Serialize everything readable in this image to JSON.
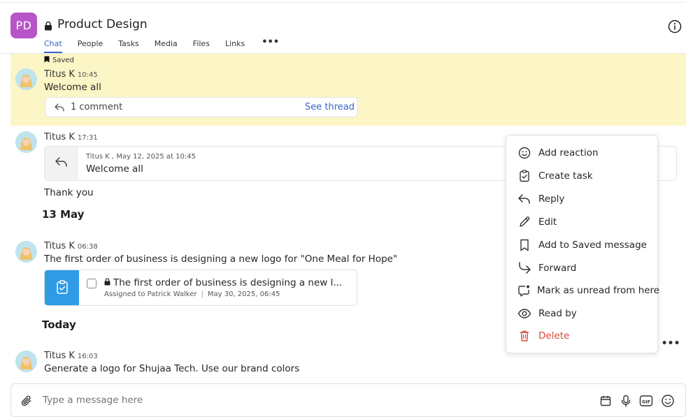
{
  "header": {
    "avatar_initials": "PD",
    "avatar_color": "#b755c8",
    "title": "Product Design",
    "tabs": [
      {
        "label": "Chat",
        "active": true
      },
      {
        "label": "People"
      },
      {
        "label": "Tasks"
      },
      {
        "label": "Media"
      },
      {
        "label": "Files"
      },
      {
        "label": "Links"
      }
    ],
    "more_label": "•••",
    "icons": {
      "lock": "lock-icon",
      "info": "info-icon"
    }
  },
  "saved_message": {
    "tag": "Saved",
    "author": "Titus K",
    "time": "10:45",
    "text": "Welcome all",
    "comment_count": "1 comment",
    "see_thread": "See thread",
    "highlight_color": "#fcf5c6"
  },
  "reply_message": {
    "author": "Titus K",
    "time": "17:31",
    "quote_meta": "Titus K , May 12, 2025 at 10:45",
    "quote_text": "Welcome all",
    "text": "Thank you"
  },
  "date_separators": [
    "13 May",
    "Today"
  ],
  "task_message": {
    "author": "Titus K",
    "time": "06:38",
    "text": "The first order of business is designing a new logo for \"One Meal for Hope\"",
    "task_title": "The first order of business is designing a new l...",
    "assigned_label": "Assigned to",
    "assignee": "Patrick Walker",
    "due": "May 30, 2025, 06:45"
  },
  "today_message": {
    "author": "Titus K",
    "time": "16:03",
    "text": "Generate a logo for Shujaa Tech. Use our brand colors",
    "more_label": "•••"
  },
  "context_menu": [
    {
      "label": "Add reaction",
      "icon": "smile-icon"
    },
    {
      "label": "Create task",
      "icon": "task-icon"
    },
    {
      "label": "Reply",
      "icon": "reply-icon"
    },
    {
      "label": "Edit",
      "icon": "pencil-icon"
    },
    {
      "label": "Add to Saved message",
      "icon": "bookmark-icon"
    },
    {
      "label": "Forward",
      "icon": "forward-icon"
    },
    {
      "label": "Mark as unread from here",
      "icon": "unread-icon"
    },
    {
      "label": "Read by",
      "icon": "eye-icon"
    },
    {
      "label": "Delete",
      "icon": "trash-icon",
      "danger": true
    }
  ],
  "composer": {
    "placeholder": "Type a message here",
    "icons": [
      "paperclip-icon",
      "calendar-icon",
      "microphone-icon",
      "gif-icon",
      "emoji-icon"
    ]
  },
  "colors": {
    "accent": "#3a66c9",
    "danger": "#d9473b",
    "task_blue": "#2f9ae6"
  }
}
